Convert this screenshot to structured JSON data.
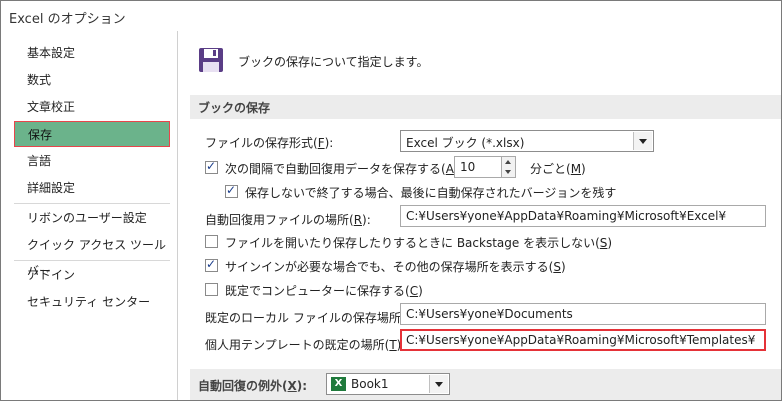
{
  "window": {
    "title": "Excel のオプション"
  },
  "sidebar": {
    "items": [
      {
        "label": "基本設定"
      },
      {
        "label": "数式"
      },
      {
        "label": "文章校正"
      },
      {
        "label": "保存"
      },
      {
        "label": "言語"
      },
      {
        "label": "詳細設定"
      },
      {
        "label": "リボンのユーザー設定"
      },
      {
        "label": "クイック アクセス ツール バー"
      },
      {
        "label": "アドイン"
      },
      {
        "label": "セキュリティ センター"
      }
    ],
    "selected": "保存"
  },
  "header": {
    "text": "ブックの保存について指定します。",
    "icon": "floppy-disk-icon"
  },
  "sections": {
    "save_workbooks": {
      "title": "ブックの保存"
    },
    "autorecover_exceptions": {
      "title_prefix": "自動回復の例外(",
      "title_key": "X",
      "title_suffix": "):"
    }
  },
  "options": {
    "format": {
      "label_prefix": "ファイルの保存形式(",
      "key": "F",
      "label_suffix": "):",
      "value": "Excel ブック (*.xlsx)"
    },
    "autorecover": {
      "checked": true,
      "label_prefix": "次の間隔で自動回復用データを保存する(",
      "key": "A",
      "label_suffix": "):",
      "value": "10",
      "unit_prefix": "分ごと(",
      "unit_key": "M",
      "unit_suffix": ")"
    },
    "keep_last": {
      "checked": true,
      "label": "保存しないで終了する場合、最後に自動保存されたバージョンを残す"
    },
    "autorecover_location": {
      "label_prefix": "自動回復用ファイルの場所(",
      "key": "R",
      "label_suffix": "):",
      "value": "C:¥Users¥yone¥AppData¥Roaming¥Microsoft¥Excel¥"
    },
    "no_backstage": {
      "checked": false,
      "label_prefix": "ファイルを開いたり保存したりするときに Backstage を表示しない(",
      "key": "S",
      "label_suffix": ")"
    },
    "show_other_locations": {
      "checked": true,
      "label_prefix": "サインインが必要な場合でも、その他の保存場所を表示する(",
      "key": "S",
      "label_suffix": ")"
    },
    "save_to_computer": {
      "checked": false,
      "label_prefix": "既定でコンピューターに保存する(",
      "key": "C",
      "label_suffix": ")"
    },
    "default_local": {
      "label_prefix": "既定のローカル ファイルの保存場所(",
      "key": "I",
      "label_suffix": "):",
      "value": "C:¥Users¥yone¥Documents"
    },
    "personal_templates": {
      "label_prefix": "個人用テンプレートの既定の場所(",
      "key": "T",
      "label_suffix": "):",
      "value": "C:¥Users¥yone¥AppData¥Roaming¥Microsoft¥Templates¥"
    },
    "exceptions_workbook": {
      "value": "Book1",
      "icon": "excel-file-icon",
      "icon_text": "X"
    }
  },
  "colors": {
    "selected_bg": "#6bb38b",
    "highlight_border": "#e53238",
    "section_bg": "#ececec"
  }
}
